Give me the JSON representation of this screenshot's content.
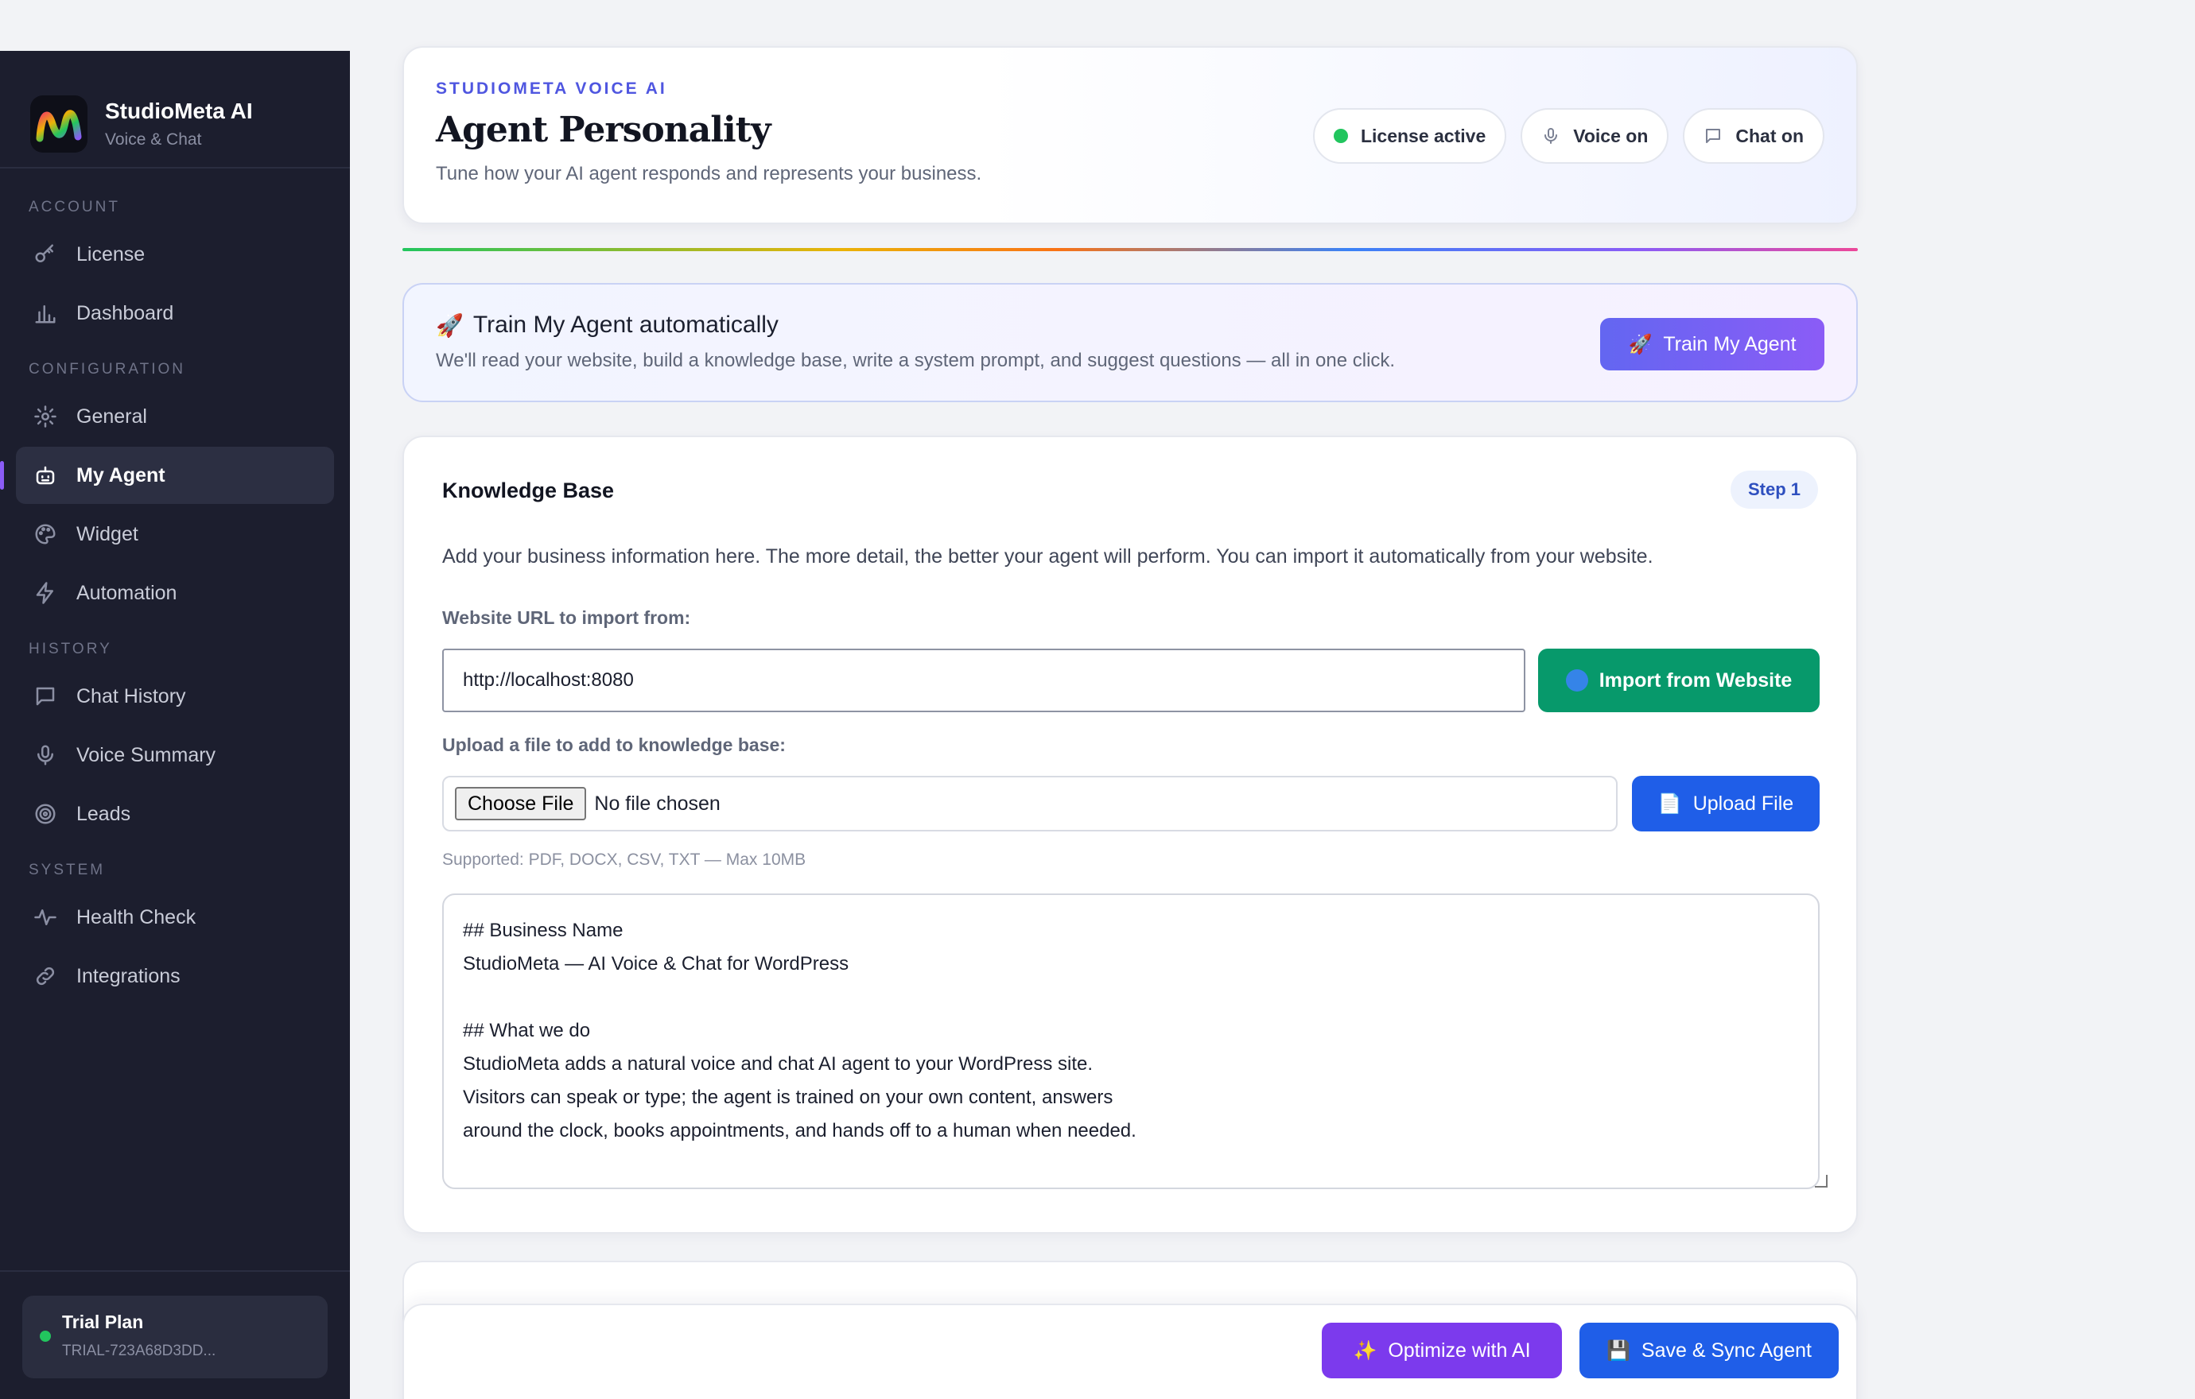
{
  "brand": {
    "name": "StudioMeta AI",
    "subtitle": "Voice & Chat"
  },
  "sidebar": {
    "sections": [
      {
        "title": "ACCOUNT",
        "items": [
          {
            "label": "License",
            "icon": "key-icon"
          },
          {
            "label": "Dashboard",
            "icon": "bar-chart-icon"
          }
        ]
      },
      {
        "title": "CONFIGURATION",
        "items": [
          {
            "label": "General",
            "icon": "gear-icon"
          },
          {
            "label": "My Agent",
            "icon": "robot-icon",
            "active": true
          },
          {
            "label": "Widget",
            "icon": "palette-icon"
          },
          {
            "label": "Automation",
            "icon": "lightning-icon"
          }
        ]
      },
      {
        "title": "HISTORY",
        "items": [
          {
            "label": "Chat History",
            "icon": "chat-bubble-icon"
          },
          {
            "label": "Voice Summary",
            "icon": "microphone-icon"
          },
          {
            "label": "Leads",
            "icon": "target-icon"
          }
        ]
      },
      {
        "title": "SYSTEM",
        "items": [
          {
            "label": "Health Check",
            "icon": "pulse-icon"
          },
          {
            "label": "Integrations",
            "icon": "link-icon"
          }
        ]
      }
    ],
    "plan": {
      "name": "Trial Plan",
      "key": "TRIAL-723A68D3DD..."
    }
  },
  "header": {
    "eyebrow": "STUDIOMETA VOICE AI",
    "title": "Agent Personality",
    "subtitle": "Tune how your AI agent responds and represents your business.",
    "pills": {
      "license": "License active",
      "voice": "Voice on",
      "chat": "Chat on"
    }
  },
  "train": {
    "icon": "🚀",
    "title": "Train My Agent automatically",
    "subtitle": "We'll read your website, build a knowledge base, write a system prompt, and suggest questions — all in one click.",
    "button": "Train My Agent"
  },
  "knowledge_base": {
    "title": "Knowledge Base",
    "step": "Step 1",
    "description": "Add your business information here. The more detail, the better your agent will perform. You can import it automatically from your website.",
    "url_label": "Website URL to import from:",
    "url_value": "http://localhost:8080",
    "import_button": "Import from Website",
    "upload_label": "Upload a file to add to knowledge base:",
    "choose_file": "Choose File",
    "no_file": "No file chosen",
    "upload_button": "Upload File",
    "supported": "Supported: PDF, DOCX, CSV, TXT — Max 10MB",
    "content": "## Business Name\nStudioMeta — AI Voice & Chat for WordPress\n\n## What we do\nStudioMeta adds a natural voice and chat AI agent to your WordPress site.\nVisitors can speak or type; the agent is trained on your own content, answers\naround the clock, books appointments, and hands off to a human when needed.\n\n## Services"
  },
  "actions": {
    "optimize": "Optimize with AI",
    "save": "Save & Sync Agent"
  },
  "colors": {
    "sidebar_bg": "#1c1e2e",
    "accent": "#6366f1",
    "import_green": "#07996b",
    "primary_blue": "#1f5ee8",
    "optimize_purple": "#7c3aed",
    "status_green": "#22c55e"
  }
}
